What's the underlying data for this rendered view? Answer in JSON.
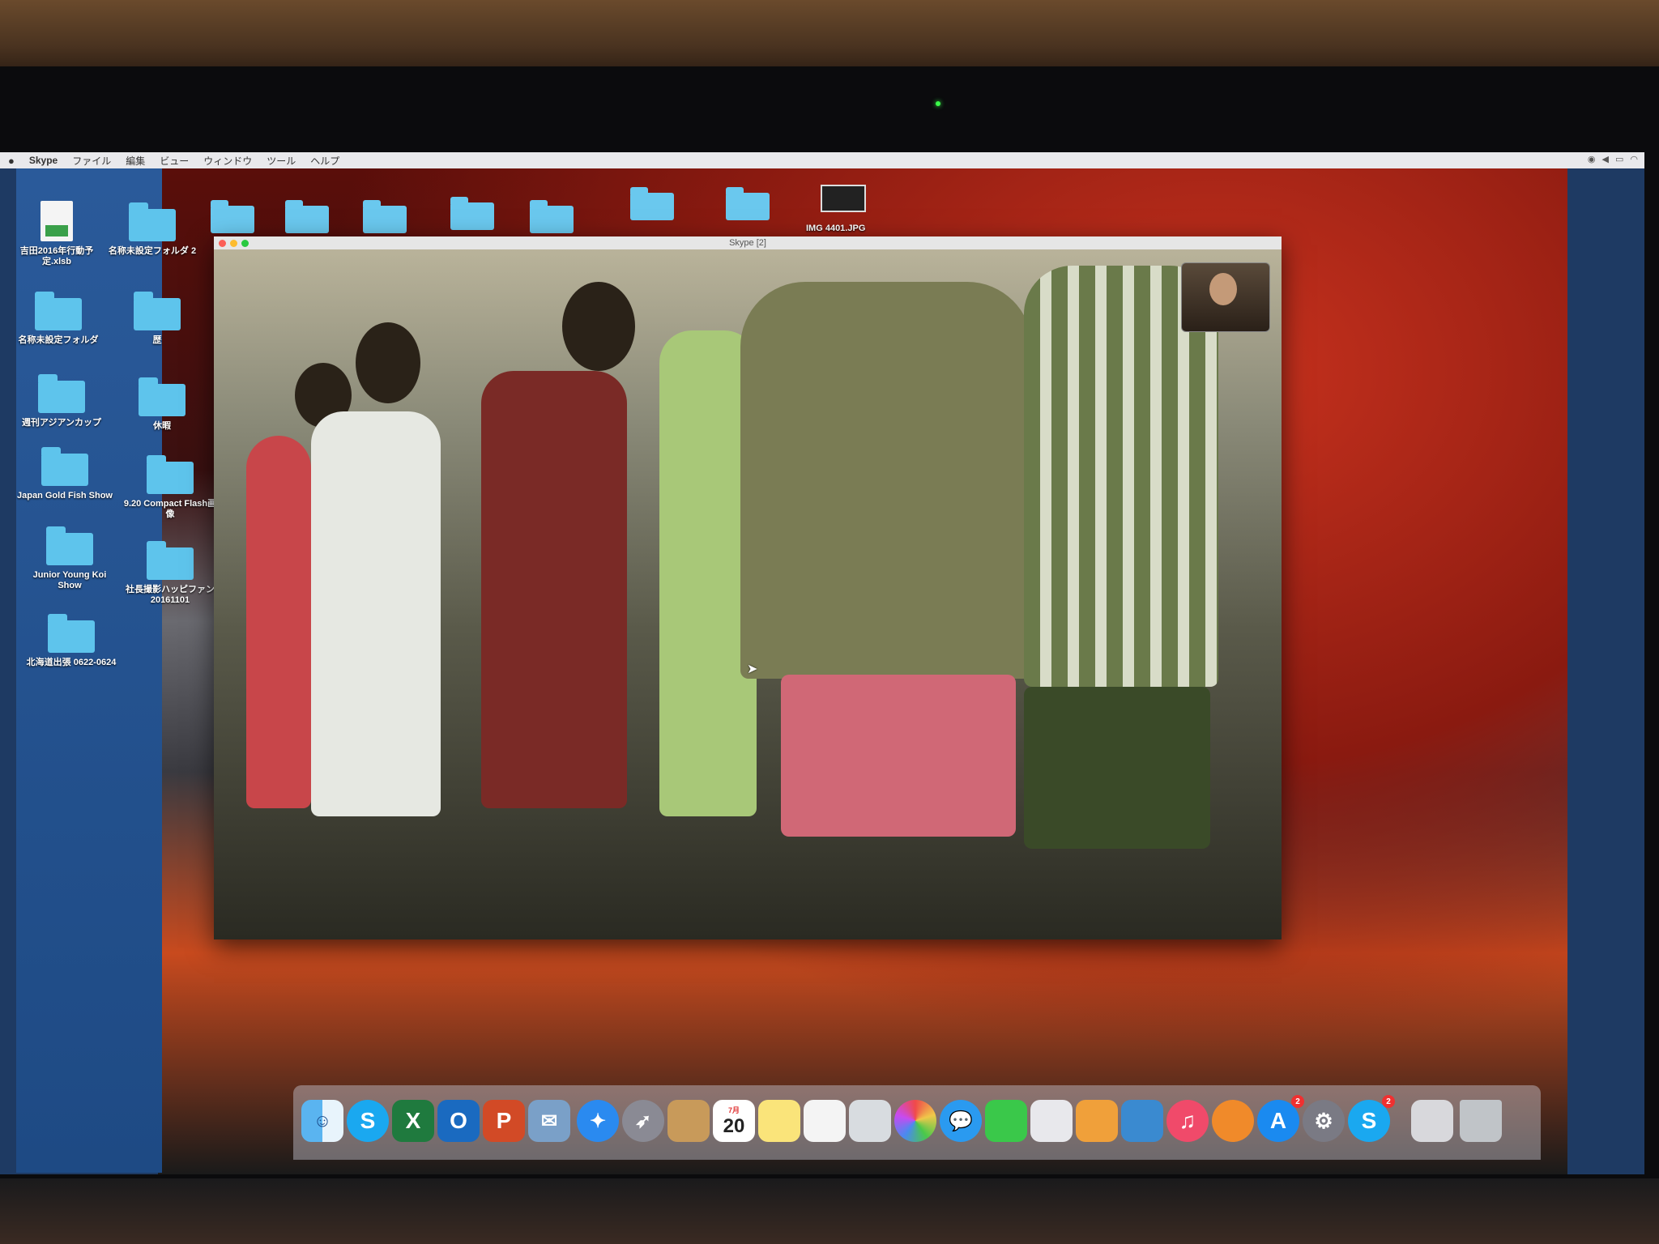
{
  "menubar": {
    "apple": "",
    "app_name": "Skype",
    "items": [
      "ファイル",
      "編集",
      "ビュー",
      "ウィンドウ",
      "ツール",
      "ヘルプ"
    ]
  },
  "desktop": {
    "icons": [
      {
        "label": "吉田2016年行動予定.xlsb",
        "type": "xlsx"
      },
      {
        "label": "名称未設定フォルダ 2",
        "type": "folder"
      },
      {
        "label": "名称未設定フォルダ",
        "type": "folder"
      },
      {
        "label": "歴",
        "type": "folder"
      },
      {
        "label": "週刊アジアンカップ",
        "type": "folder"
      },
      {
        "label": "休暇",
        "type": "folder"
      },
      {
        "label": "Japan Gold Fish Show",
        "type": "folder"
      },
      {
        "label": "9.20 Compact Flash画像",
        "type": "folder"
      },
      {
        "label": "Junior Young Koi Show",
        "type": "folder"
      },
      {
        "label": "社長撮影ハッピファン 20161101",
        "type": "folder"
      },
      {
        "label": "北海道出張 0622-0624",
        "type": "folder"
      }
    ],
    "image_file": "IMG 4401.JPG"
  },
  "skype_window": {
    "title": "Skype [2]"
  },
  "dock": {
    "calendar_day": "20",
    "calendar_month": "7月",
    "badges": {
      "app_store": "2",
      "skype": "2"
    }
  }
}
